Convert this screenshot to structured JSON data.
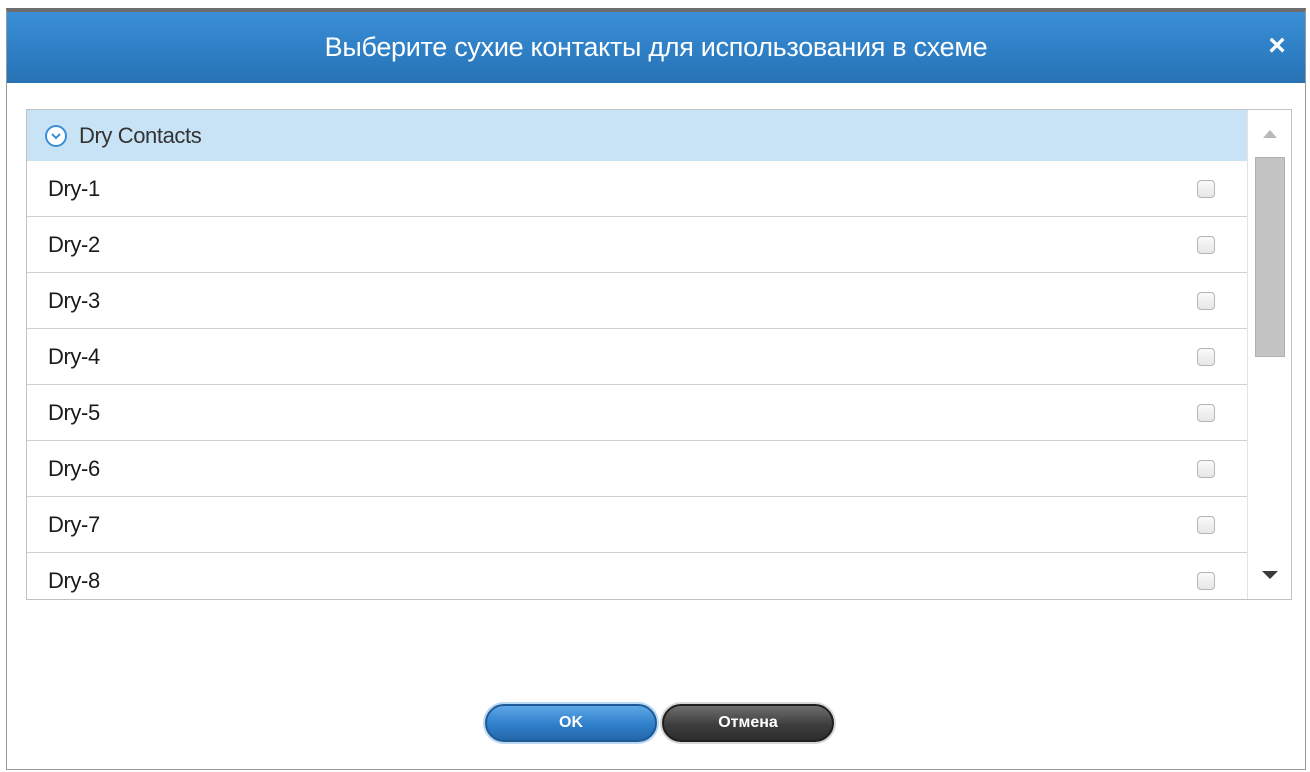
{
  "dialog": {
    "title": "Выберите сухие контакты для использования в схеме",
    "close_label": "×"
  },
  "group": {
    "label": "Dry Contacts",
    "expanded": true
  },
  "items": [
    {
      "label": "Dry-1",
      "checked": false
    },
    {
      "label": "Dry-2",
      "checked": false
    },
    {
      "label": "Dry-3",
      "checked": false
    },
    {
      "label": "Dry-4",
      "checked": false
    },
    {
      "label": "Dry-5",
      "checked": false
    },
    {
      "label": "Dry-6",
      "checked": false
    },
    {
      "label": "Dry-7",
      "checked": false
    },
    {
      "label": "Dry-8",
      "checked": false
    }
  ],
  "buttons": {
    "ok_label": "OK",
    "cancel_label": "Отмена"
  },
  "icons": {
    "expand": "chevron-down-circle-icon",
    "close": "close-icon",
    "scroll_up": "scroll-up-arrow-icon",
    "scroll_down": "scroll-down-arrow-icon"
  },
  "colors": {
    "titlebar": "#2e7fc5",
    "group_header": "#c8e3f5",
    "ok_button": "#2f7fcb",
    "cancel_button": "#3e3e3e"
  }
}
